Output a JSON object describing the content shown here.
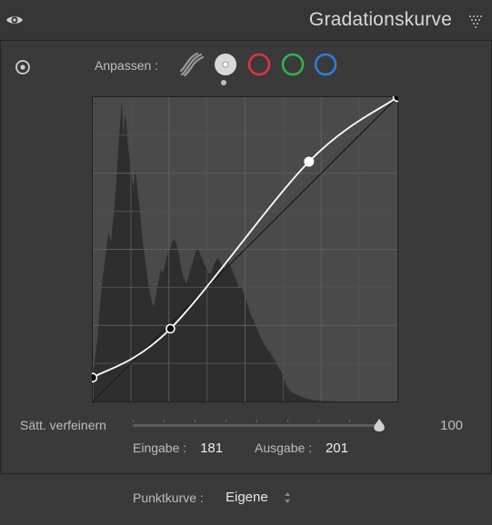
{
  "header": {
    "title": "Gradationskurve",
    "eye_icon": "eye-icon",
    "collapse_icon": "collapse-triangle-icon"
  },
  "adjust": {
    "label": "Anpassen :",
    "channels": [
      {
        "name": "parametric-icon",
        "active": false
      },
      {
        "name": "point-rgb",
        "active": true,
        "color": "#d9d9d9"
      },
      {
        "name": "red",
        "active": false,
        "color": "#e0343a"
      },
      {
        "name": "green",
        "active": false,
        "color": "#36b34a"
      },
      {
        "name": "blue",
        "active": false,
        "color": "#2f7de0"
      }
    ]
  },
  "curve": {
    "points": [
      {
        "input": 0,
        "output": 20
      },
      {
        "input": 65,
        "output": 61
      },
      {
        "input": 181,
        "output": 201
      },
      {
        "input": 255,
        "output": 255
      }
    ],
    "selected_point_index": 2,
    "grid_divisions": 4
  },
  "saturation": {
    "label": "Sätt. verfeinern",
    "value": "100"
  },
  "io": {
    "input_label": "Eingabe :",
    "input_value": "181",
    "output_label": "Ausgabe :",
    "output_value": "201"
  },
  "footer": {
    "label": "Punktkurve :",
    "value": "Eigene"
  },
  "colors": {
    "panel_bg": "#3a3a3a",
    "curve_bg": "#4a4a4a",
    "histogram": "#2d2d2d",
    "curve_line": "#ffffff"
  }
}
